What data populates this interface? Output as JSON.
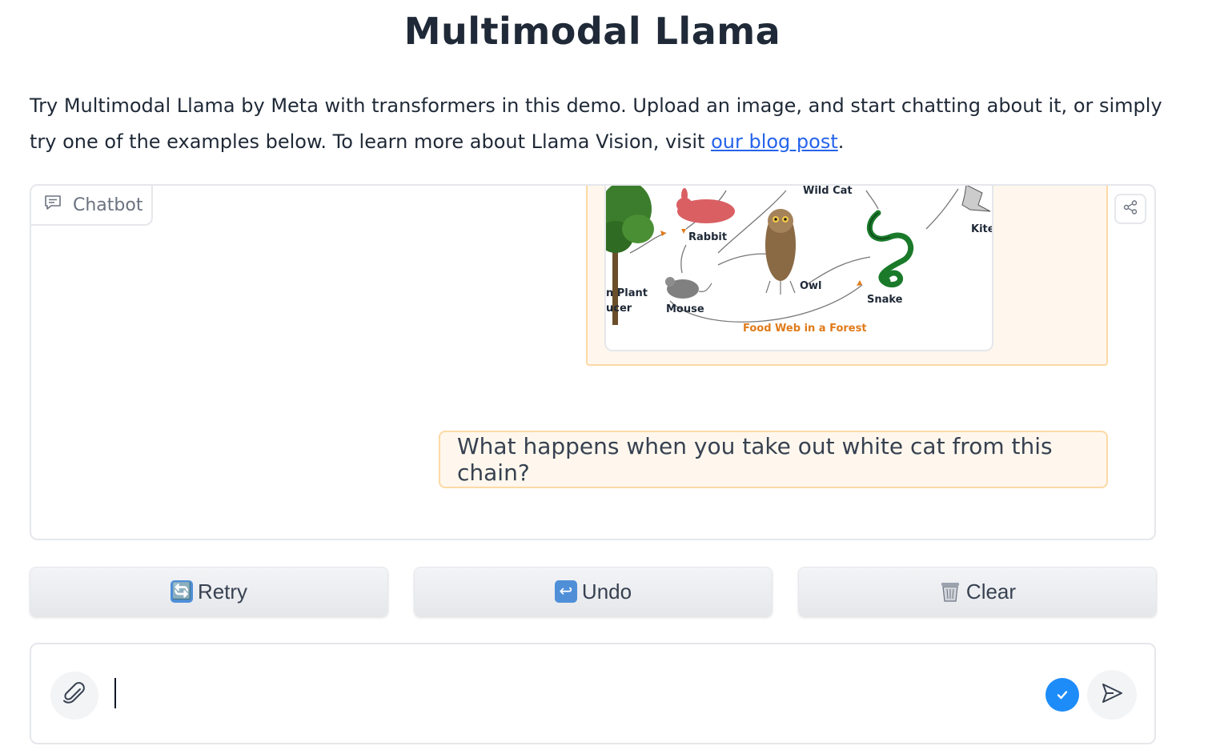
{
  "page": {
    "title": "Multimodal Llama",
    "description_text": "Try Multimodal Llama by Meta with transformers in this demo. Upload an image, and start chatting about it, or simply try one of the examples below. To learn more about Llama Vision, visit ",
    "blog_link_text": "our blog post",
    "description_end": "."
  },
  "chatbot": {
    "label": "Chatbot",
    "label_icon": "chat-bubble-icon",
    "share_icon": "share-icon",
    "image_labels": {
      "wild_cat": "Wild Cat",
      "rabbit": "Rabbit",
      "kite": "Kite",
      "plant": "n Plant",
      "producer": "ucer",
      "mouse": "Mouse",
      "owl": "Owl",
      "snake": "Snake",
      "caption": "Food Web in a Forest"
    },
    "user_message": "What happens when you take out white cat from this chain?"
  },
  "actions": {
    "retry_label": "Retry",
    "retry_icon": "🔄",
    "undo_label": "Undo",
    "undo_icon": "↩",
    "clear_label": "Clear",
    "clear_icon": "trash-icon"
  },
  "input": {
    "value": "",
    "placeholder": "",
    "attach_icon": "paperclip-icon",
    "check_icon": "check-icon",
    "send_icon": "send-icon"
  },
  "colors": {
    "accent_blue": "#1d8cf8",
    "bubble_bg": "#fff7ed",
    "bubble_border": "#fcd9a4",
    "link": "#2563eb"
  }
}
